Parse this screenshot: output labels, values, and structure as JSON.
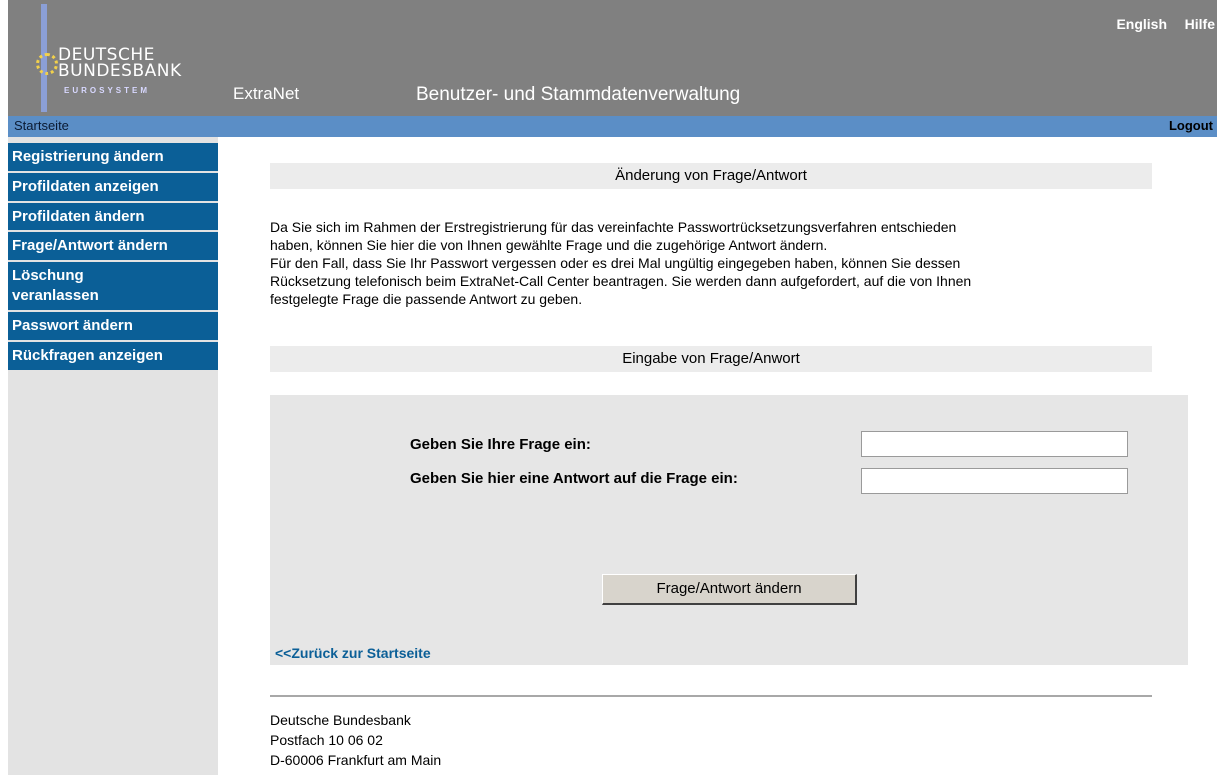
{
  "header": {
    "logo_line1": "DEUTSCHE",
    "logo_line2": "BUNDESBANK",
    "logo_line3": "EUROSYSTEM",
    "app_name": "ExtraNet",
    "subtitle": "Benutzer- und Stammdatenverwaltung",
    "lang_link": "English",
    "help_link": "Hilfe"
  },
  "navbar": {
    "start": "Startseite",
    "logout": "Logout"
  },
  "sidebar": {
    "items": [
      {
        "label": "Registrierung ändern"
      },
      {
        "label": "Profildaten anzeigen"
      },
      {
        "label": "Profildaten ändern"
      },
      {
        "label": "Frage/Antwort ändern"
      },
      {
        "label": "Löschung veranlassen"
      },
      {
        "label": "Passwort ändern"
      },
      {
        "label": "Rückfragen anzeigen"
      }
    ]
  },
  "main": {
    "section1_title": "Änderung von Frage/Antwort",
    "intro_line1": "Da Sie sich im Rahmen der Erstregistrierung für das vereinfachte Passwortrücksetzungsverfahren entschieden",
    "intro_line2": "haben, können Sie hier die von Ihnen gewählte Frage und die zugehörige Antwort ändern.",
    "intro_line3": "Für den Fall, dass Sie Ihr Passwort vergessen oder es drei Mal ungültig eingegeben haben, können Sie dessen",
    "intro_line4": "Rücksetzung telefonisch beim ExtraNet-Call Center beantragen. Sie werden dann aufgefordert, auf die von Ihnen",
    "intro_line5": "festgelegte Frage die passende Antwort zu geben.",
    "section2_title": "Eingabe von Frage/Anwort",
    "question_label": "Geben Sie Ihre Frage ein:",
    "question_value": "",
    "answer_label": "Geben Sie hier eine Antwort auf die Frage ein:",
    "answer_value": "",
    "submit_label": "Frage/Antwort ändern",
    "back_link": "<<Zurück zur Startseite"
  },
  "footer": {
    "line1": "Deutsche Bundesbank",
    "line2": "Postfach 10 06 02",
    "line3": "D-60006 Frankfurt am Main"
  },
  "colors": {
    "header_bg": "#808080",
    "nav_bg": "#5b8ec6",
    "sidebar_item_bg": "#0b5f97",
    "sidebar_bg": "#e3e3e3",
    "section_bar_bg": "#ececec",
    "form_bg": "#e6e6e6"
  }
}
